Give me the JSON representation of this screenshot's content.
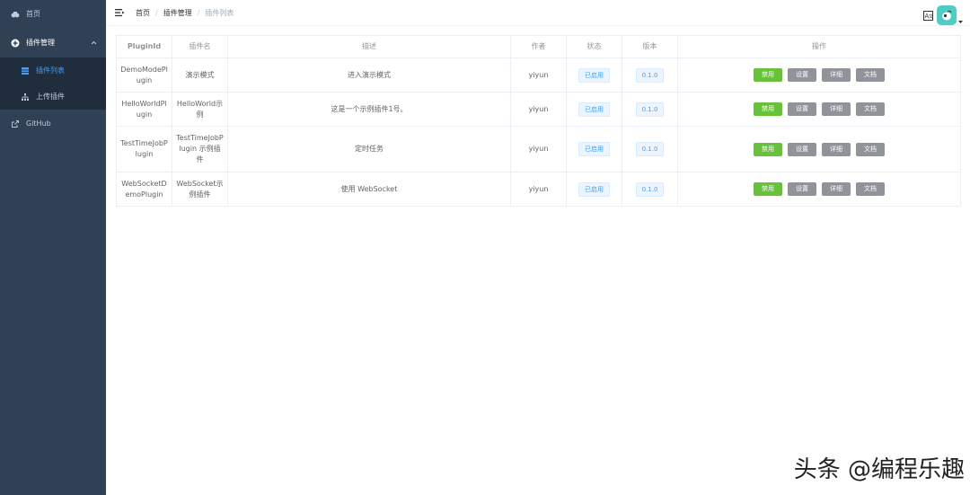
{
  "sidebar": {
    "home": "首页",
    "plugin_mgmt": "插件管理",
    "plugin_list": "插件列表",
    "upload_plugin": "上传插件",
    "github": "GitHub"
  },
  "header": {
    "breadcrumb": [
      "首页",
      "插件管理",
      "插件列表"
    ],
    "separator": "/"
  },
  "table": {
    "headers": [
      "PluginId",
      "插件名",
      "描述",
      "作者",
      "状态",
      "版本",
      "操作"
    ],
    "rows": [
      {
        "id": "DemoModePlugin",
        "name": "演示模式",
        "desc": "进入演示模式",
        "author": "yiyun",
        "status": "已启用",
        "version": "0.1.0"
      },
      {
        "id": "HelloWorldPlugin",
        "name": "HelloWorld示例",
        "desc": "这是一个示例插件1号。",
        "author": "yiyun",
        "status": "已启用",
        "version": "0.1.0"
      },
      {
        "id": "TestTimeJobPlugin",
        "name": "TestTimeJobPlugin 示例插件",
        "desc": "定时任务",
        "author": "yiyun",
        "status": "已启用",
        "version": "0.1.0"
      },
      {
        "id": "WebSocketDemoPlugin",
        "name": "WebSocket示例插件",
        "desc": "使用 WebSocket",
        "author": "yiyun",
        "status": "已启用",
        "version": "0.1.0"
      }
    ],
    "actions": {
      "disable": "禁用",
      "settings": "设置",
      "detail": "详细",
      "docs": "文档"
    }
  },
  "watermark": "头条 @编程乐趣",
  "colors": {
    "sidebar_bg": "#304156",
    "active": "#409eff",
    "green": "#67c23a",
    "gray": "#909399"
  }
}
